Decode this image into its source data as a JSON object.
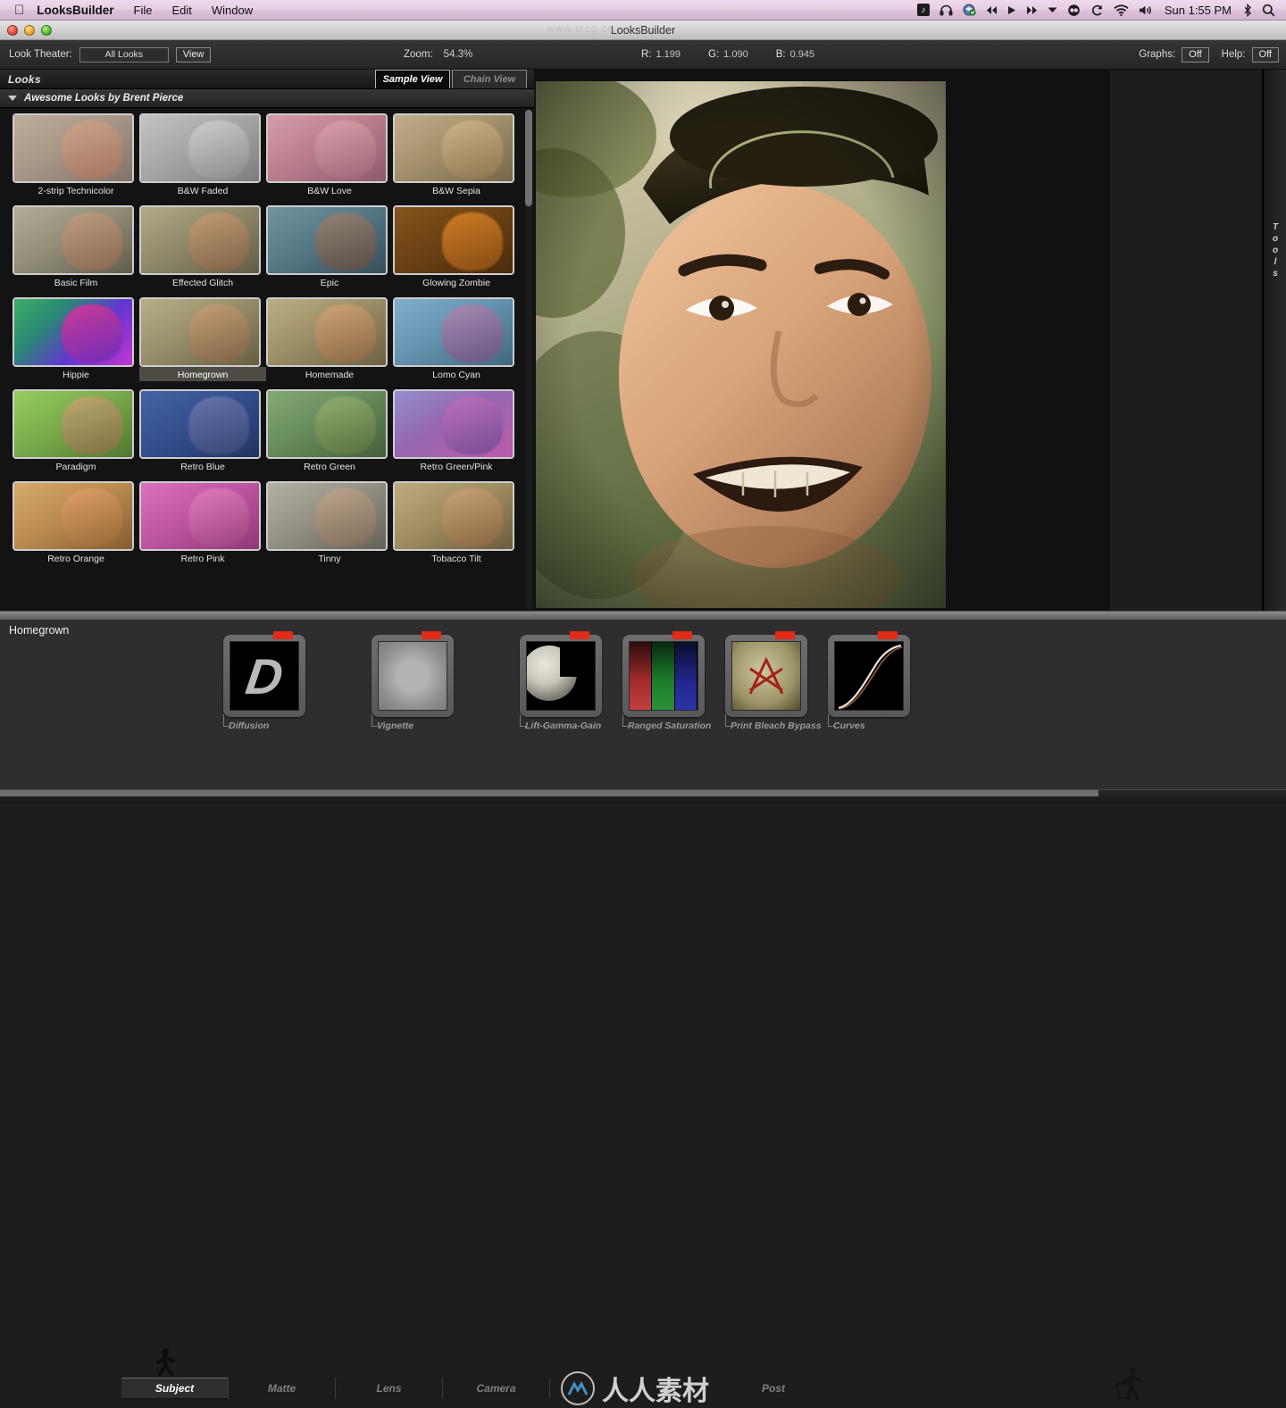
{
  "menubar": {
    "apple_icon": "apple-icon",
    "app_name": "LooksBuilder",
    "menus": [
      "File",
      "Edit",
      "Window"
    ],
    "tray_icons": [
      "music-note-icon",
      "headphones-icon",
      "dropbox-icon",
      "rewind-icon",
      "play-icon",
      "fastforward-icon",
      "chevron-down-icon",
      "spotlight-eclipse-icon",
      "sync-icon",
      "wifi-icon",
      "volume-icon",
      "bluetooth-icon",
      "search-icon"
    ],
    "clock": "Sun 1:55 PM"
  },
  "window": {
    "title": "LooksBuilder",
    "traffic_lights": [
      "close-button",
      "minimize-button",
      "zoom-button"
    ]
  },
  "toolbar": {
    "look_theater_label": "Look Theater:",
    "look_theater_value": "All Looks",
    "view_button": "View",
    "zoom_label": "Zoom:",
    "zoom_value": "54.3%",
    "rgb": [
      {
        "key": "R:",
        "value": "1.199"
      },
      {
        "key": "G:",
        "value": "1.090"
      },
      {
        "key": "B:",
        "value": "0.945"
      }
    ],
    "graphs_label": "Graphs:",
    "graphs_value": "Off",
    "help_label": "Help:",
    "help_value": "Off"
  },
  "looks_panel": {
    "title": "Looks",
    "tabs": [
      {
        "label": "Sample View",
        "active": true
      },
      {
        "label": "Chain View",
        "active": false
      }
    ],
    "group_name": "Awesome Looks by Brent Pierce",
    "selected_look": "Homegrown",
    "looks": [
      {
        "label": "2-strip Technicolor",
        "sky": "linear-gradient(150deg,#c0b49c 0%,#a7998a 45%,#7d6f66 100%)",
        "face": "linear-gradient(160deg,#cfa98e,#a0715b)",
        "overlay": "rgba(180,140,120,0.12)"
      },
      {
        "label": "B&W Faded",
        "sky": "linear-gradient(150deg,#bdbdbd 0%,#9d9d9d 45%,#6f6f6f 100%)",
        "face": "linear-gradient(160deg,#c9c9c9,#7e7e7e)",
        "overlay": "rgba(255,255,255,0.10)"
      },
      {
        "label": "B&W Love",
        "sky": "linear-gradient(150deg,#d8a5ae 0%,#b77f8e 45%,#7d5460 100%)",
        "face": "linear-gradient(160deg,#e0a9b0,#8f6270)",
        "overlay": "rgba(210,120,150,0.18)"
      },
      {
        "label": "B&W Sepia",
        "sky": "linear-gradient(150deg,#c6b392 0%,#a3906e 45%,#6e5f46 100%)",
        "face": "linear-gradient(160deg,#d2bb92,#86714f)",
        "overlay": "rgba(180,150,90,0.14)"
      },
      {
        "label": "Basic Film",
        "sky": "linear-gradient(150deg,#b9b49e 0%,#97927d 45%,#5e5c4d 100%)",
        "face": "linear-gradient(160deg,#c7a485,#8a6650)",
        "overlay": "rgba(120,120,90,0.10)"
      },
      {
        "label": "Effected Glitch",
        "sky": "linear-gradient(150deg,#b6b08f 0%,#8f8a6d 45%,#5a5743 100%)",
        "face": "linear-gradient(160deg,#c8a078,#7d5c45)",
        "overlay": "rgba(150,140,90,0.12)"
      },
      {
        "label": "Epic",
        "sky": "linear-gradient(150deg,#7fa0a8 0%,#5c7d88 45%,#32464f 100%)",
        "face": "linear-gradient(160deg,#a88a72,#5c4436)",
        "overlay": "rgba(70,110,130,0.22)"
      },
      {
        "label": "Glowing Zombie",
        "sky": "linear-gradient(150deg,#6a4a1e 0%,#4b3214 45%,#241708 100%)",
        "face": "linear-gradient(160deg,#c47a2a,#6b3d12)",
        "overlay": "rgba(255,140,20,0.18)"
      },
      {
        "label": "Hippie",
        "sky": "linear-gradient(135deg,#2fd14f 0%,#15a35c 30%,#5d3ad6 62%,#d63ad0 100%)",
        "face": "linear-gradient(160deg,#e0408a,#6b2fb5)",
        "overlay": "rgba(120,40,200,0.20)"
      },
      {
        "label": "Homegrown",
        "sky": "linear-gradient(150deg,#bcb491 0%,#99916f 45%,#5f5a42 100%)",
        "face": "linear-gradient(160deg,#c9a47c,#7e5d44)",
        "overlay": "rgba(150,140,80,0.10)"
      },
      {
        "label": "Homemade",
        "sky": "linear-gradient(150deg,#c0b38d 0%,#9b8f6a 45%,#625a40 100%)",
        "face": "linear-gradient(160deg,#d3a87b,#856044)",
        "overlay": "rgba(170,150,80,0.12)"
      },
      {
        "label": "Lomo Cyan",
        "sky": "linear-gradient(150deg,#8fb6cf 0%,#6b93ad 45%,#3d5a6e 100%)",
        "face": "linear-gradient(160deg,#c08ab0,#6b4470)",
        "overlay": "rgba(80,150,190,0.22)"
      },
      {
        "label": "Paradigm",
        "sky": "linear-gradient(150deg,#9fd06a 0%,#7ba84c 45%,#48662c 100%)",
        "face": "linear-gradient(160deg,#cfa77a,#7d5c3f)",
        "overlay": "rgba(120,190,70,0.20)"
      },
      {
        "label": "Retro Blue",
        "sky": "linear-gradient(150deg,#4d6fa8 0%,#3a5488 45%,#1f2d4d 100%)",
        "face": "linear-gradient(160deg,#7b86b4,#3c4468)",
        "overlay": "rgba(40,70,160,0.26)"
      },
      {
        "label": "Retro Green",
        "sky": "linear-gradient(150deg,#8fae7f 0%,#6c8a5f 45%,#3c5236 100%)",
        "face": "linear-gradient(160deg,#9fb57a,#566638)",
        "overlay": "rgba(90,150,80,0.20)"
      },
      {
        "label": "Retro Green/Pink",
        "sky": "linear-gradient(150deg,#8f9fd6 0%,#8f6db0 45%,#c45fa8 100%)",
        "face": "linear-gradient(160deg,#c27bbe,#6a4a8d)",
        "overlay": "rgba(170,80,180,0.22)"
      },
      {
        "label": "Retro Orange",
        "sky": "linear-gradient(150deg,#d6b079 0%,#b68d57 45%,#6f5433 100%)",
        "face": "linear-gradient(160deg,#dca874,#8a5f3a)",
        "overlay": "rgba(220,140,50,0.18)"
      },
      {
        "label": "Retro Pink",
        "sky": "linear-gradient(150deg,#dc7fc4 0%,#b95ba1 45%,#7a3568 100%)",
        "face": "linear-gradient(160deg,#e08ec0,#8a4273)",
        "overlay": "rgba(220,70,170,0.22)"
      },
      {
        "label": "Tinny",
        "sky": "linear-gradient(150deg,#b7b4a6 0%,#949184 45%,#5c5a52 100%)",
        "face": "linear-gradient(160deg,#c2a88f,#7c6552)",
        "overlay": "rgba(160,160,150,0.10)"
      },
      {
        "label": "Tobacco Tilt",
        "sky": "linear-gradient(150deg,#c3b08a 0%,#9e8c66 45%,#5f5238 100%)",
        "face": "linear-gradient(160deg,#cda77c,#7e5d3f)",
        "overlay": "rgba(180,150,80,0.16)"
      }
    ]
  },
  "rail": {
    "label": "Tools",
    "letters": [
      "T",
      "o",
      "o",
      "l",
      "s"
    ]
  },
  "bottom_panel": {
    "look_name": "Homegrown",
    "tools": [
      {
        "label": "Diffusion",
        "icon": "diffusion-icon",
        "enabled": true
      },
      {
        "label": "Vignette",
        "icon": "vignette-icon",
        "enabled": true
      },
      {
        "label": "Lift-Gamma-Gain",
        "icon": "lift-gamma-gain-icon",
        "enabled": true
      },
      {
        "label": "Ranged Saturation",
        "icon": "ranged-saturation-icon",
        "enabled": true
      },
      {
        "label": "Print Bleach Bypass",
        "icon": "print-bleach-bypass-icon",
        "enabled": true
      },
      {
        "label": "Curves",
        "icon": "curves-icon",
        "enabled": true
      }
    ],
    "category_tabs": [
      {
        "label": "Subject",
        "active": true
      },
      {
        "label": "Matte",
        "active": false
      },
      {
        "label": "Lens",
        "active": false
      },
      {
        "label": "Camera",
        "active": false
      },
      {
        "label": "Post",
        "active": false
      }
    ],
    "subject_icon": "walking-person-icon",
    "trash_icon": "trash-person-icon"
  },
  "watermarks": {
    "top": "www.rrcg.cn",
    "center": "人人素材"
  },
  "colors": {
    "accent_red": "#e22b16",
    "panel_bg": "#2e2e2e",
    "dark_bg": "#141414",
    "menubar": "#e3c9dd"
  }
}
